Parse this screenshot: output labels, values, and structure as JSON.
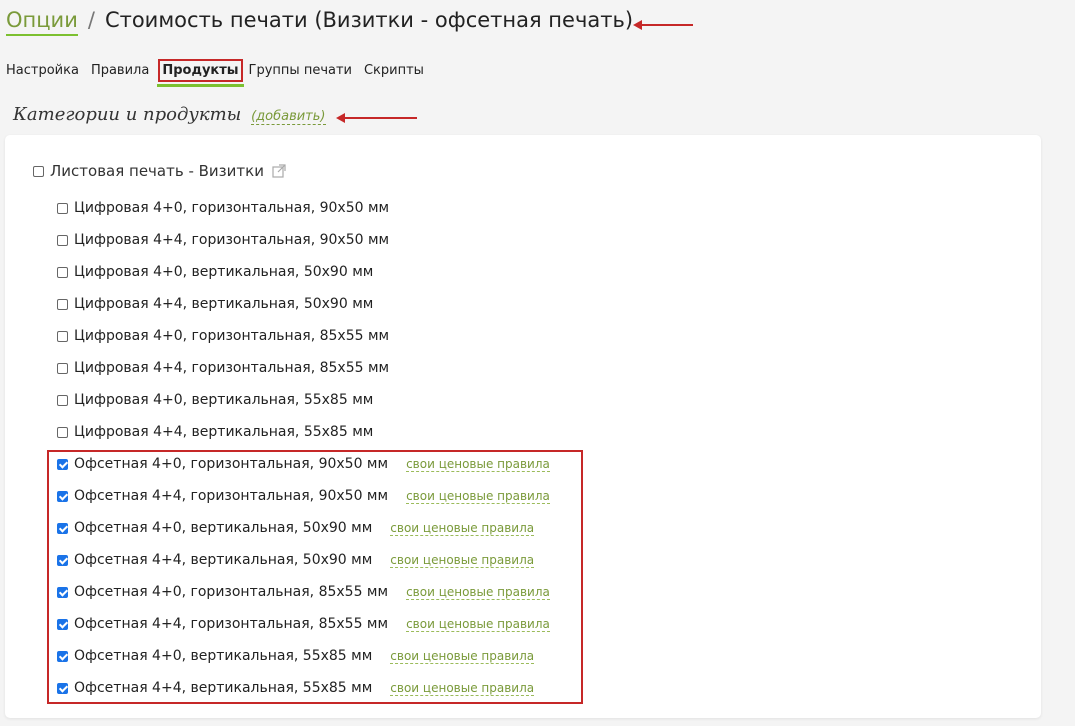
{
  "breadcrumb": {
    "root": "Опции",
    "separator": "/",
    "title": "Стоимость печати (Визитки - офсетная печать)"
  },
  "tabs": [
    {
      "label": "Настройка",
      "active": false
    },
    {
      "label": "Правила",
      "active": false
    },
    {
      "label": "Продукты",
      "active": true
    },
    {
      "label": "Группы печати",
      "active": false
    },
    {
      "label": "Скрипты",
      "active": false
    }
  ],
  "section": {
    "heading": "Категории и продукты",
    "add_label": "(добавить)"
  },
  "category": {
    "label": "Листовая печать - Визитки",
    "checked": false,
    "icon": "external-link-icon"
  },
  "rules_link_label": "свои ценовые правила",
  "products": [
    {
      "label": "Цифровая 4+0, горизонтальная, 90x50 мм",
      "checked": false
    },
    {
      "label": "Цифровая 4+4, горизонтальная, 90x50 мм",
      "checked": false
    },
    {
      "label": "Цифровая 4+0, вертикальная, 50x90 мм",
      "checked": false
    },
    {
      "label": "Цифровая 4+4, вертикальная, 50x90 мм",
      "checked": false
    },
    {
      "label": "Цифровая 4+0, горизонтальная, 85x55 мм",
      "checked": false
    },
    {
      "label": "Цифровая 4+4, горизонтальная, 85x55 мм",
      "checked": false
    },
    {
      "label": "Цифровая 4+0, вертикальная, 55x85 мм",
      "checked": false
    },
    {
      "label": "Цифровая 4+4, вертикальная, 55x85 мм",
      "checked": false
    },
    {
      "label": "Офсетная 4+0, горизонтальная, 90x50 мм",
      "checked": true
    },
    {
      "label": "Офсетная 4+4, горизонтальная, 90x50 мм",
      "checked": true
    },
    {
      "label": "Офсетная 4+0, вертикальная, 50x90 мм",
      "checked": true
    },
    {
      "label": "Офсетная 4+4, вертикальная, 50x90 мм",
      "checked": true
    },
    {
      "label": "Офсетная 4+0, горизонтальная, 85x55 мм",
      "checked": true
    },
    {
      "label": "Офсетная 4+4, горизонтальная, 85x55 мм",
      "checked": true
    },
    {
      "label": "Офсетная 4+0, вертикальная, 55x85 мм",
      "checked": true
    },
    {
      "label": "Офсетная 4+4, вертикальная, 55x85 мм",
      "checked": true
    }
  ],
  "colors": {
    "accent_green": "#7cc030",
    "link_green": "#7a9a3a",
    "annotation_red": "#c62828",
    "checkbox_blue": "#1a73e8"
  }
}
